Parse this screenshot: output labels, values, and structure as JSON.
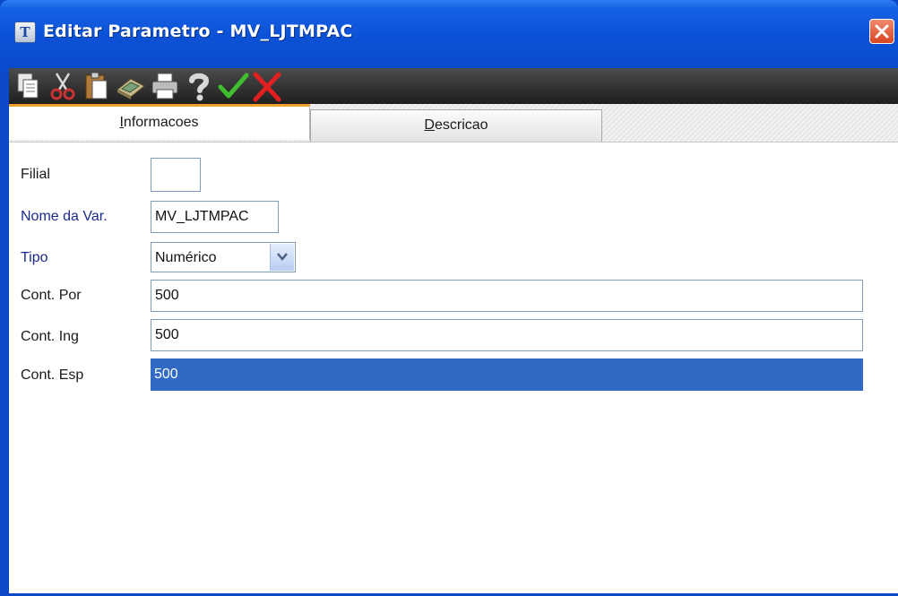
{
  "window": {
    "title": "Editar Parametro - MV_LJTMPAC",
    "app_icon_glyph": "T",
    "accent": "#0a48c8",
    "close_color": "#d7451f"
  },
  "toolbar": {
    "buttons": [
      {
        "name": "copy-icon"
      },
      {
        "name": "cut-icon"
      },
      {
        "name": "paste-icon"
      },
      {
        "name": "calculator-icon"
      },
      {
        "name": "print-icon"
      },
      {
        "name": "help-icon"
      },
      {
        "name": "confirm-check-icon"
      },
      {
        "name": "cancel-x-icon"
      }
    ]
  },
  "tabs": {
    "info": {
      "prefix": "",
      "underlined": "I",
      "rest": "nformacoes"
    },
    "desc": {
      "prefix": "",
      "underlined": "D",
      "rest": "escricao"
    }
  },
  "form": {
    "filial": {
      "label": "Filial",
      "value": ""
    },
    "nome_var": {
      "label": "Nome da Var.",
      "value": "MV_LJTMPAC"
    },
    "tipo": {
      "label": "Tipo",
      "value": "Numérico"
    },
    "cont_por": {
      "label": "Cont. Por",
      "value": "500"
    },
    "cont_ing": {
      "label": "Cont. Ing",
      "value": "500"
    },
    "cont_esp": {
      "label": "Cont. Esp",
      "value": "500"
    }
  },
  "colors": {
    "label_required": "#1d2a8c",
    "selection": "#316ac5",
    "active_tab_accent": "#f0a030"
  }
}
